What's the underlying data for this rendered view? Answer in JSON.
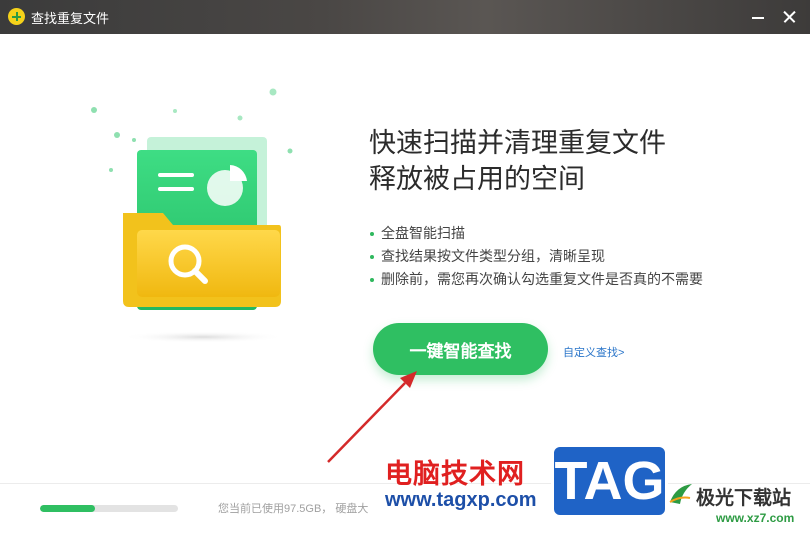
{
  "window": {
    "title": "查找重复文件",
    "icon": "duplicate-finder-app-icon",
    "minimize_icon": "minimize-icon",
    "close_icon": "close-icon"
  },
  "main": {
    "headline_line1": "快速扫描并清理重复文件",
    "headline_line2": "释放被占用的空间",
    "features": [
      "全盘智能扫描",
      "查找结果按文件类型分组，清晰呈现",
      "删除前，需您再次确认勾选重复文件是否真的不需要"
    ],
    "scan_button_label": "一键智能查找",
    "custom_search_link": "自定义查找>"
  },
  "footer": {
    "disk_usage_text": "您当前已使用97.5GB， 硬盘大",
    "disk_usage_fraction": 0.4
  },
  "watermark": {
    "site_name": "电脑技术网",
    "site_url": "www.tagxp.com",
    "tag_text": "TAG",
    "brand_name": "极光下载站",
    "brand_url": "www.xz7.com"
  },
  "colors": {
    "accent_green": "#2fbf62",
    "link_blue": "#2a75c9",
    "folder_yellow": "#f5c518",
    "title_bar": "#3f3d3b"
  }
}
